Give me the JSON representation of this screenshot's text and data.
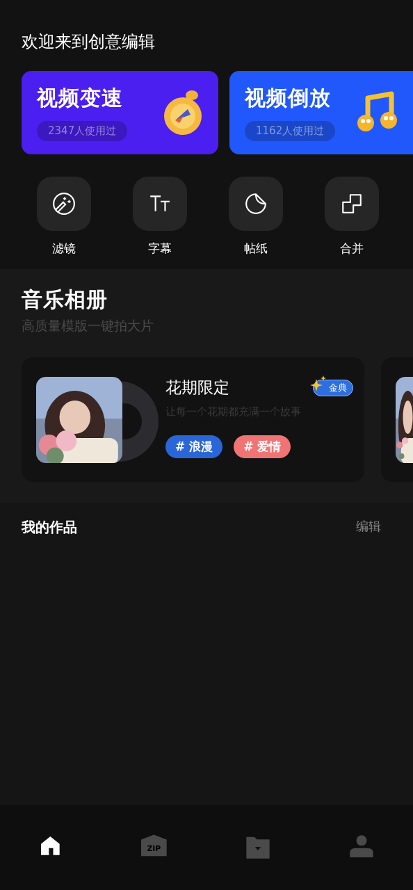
{
  "header": {
    "title": "欢迎来到创意编辑"
  },
  "feature_cards": [
    {
      "title": "视频变速",
      "usage": "2347人使用过",
      "color": "#4a1ff0",
      "kind": "stopwatch"
    },
    {
      "title": "视频倒放",
      "usage": "1162人使用过",
      "color": "#2158fb",
      "kind": "music"
    }
  ],
  "tools": [
    {
      "label": "滤镜",
      "kind": "filter"
    },
    {
      "label": "字幕",
      "kind": "text"
    },
    {
      "label": "帖纸",
      "kind": "sticker"
    },
    {
      "label": "合并",
      "kind": "merge"
    }
  ],
  "music_album": {
    "title": "音乐相册",
    "subtitle": "高质量模版一键拍大片",
    "albums": [
      {
        "title": "花期限定",
        "badge": "金典",
        "description": "让每一个花期都充满一个故事",
        "tags": [
          {
            "label": "# 浪漫",
            "color": "#2a66d8"
          },
          {
            "label": "# 爱情",
            "color": "#f07474"
          }
        ]
      },
      {
        "kind": "picture"
      }
    ]
  },
  "my_works": {
    "title": "我的作品",
    "action": "编辑"
  },
  "bottom_nav": [
    {
      "kind": "home",
      "selected": true
    },
    {
      "kind": "zip",
      "icon_text": "ZIP",
      "selected": false
    },
    {
      "kind": "folder",
      "selected": false
    },
    {
      "kind": "user",
      "selected": false
    }
  ]
}
